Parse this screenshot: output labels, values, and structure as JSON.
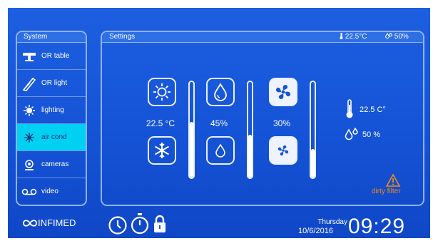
{
  "system": {
    "title": "System",
    "items": [
      {
        "label": "OR table",
        "icon": "or-table-icon",
        "active": false
      },
      {
        "label": "OR light",
        "icon": "or-light-icon",
        "active": false
      },
      {
        "label": "lighting",
        "icon": "lighting-icon",
        "active": false
      },
      {
        "label": "air cond",
        "icon": "air-cond-icon",
        "active": true
      },
      {
        "label": "cameras",
        "icon": "camera-icon",
        "active": false
      },
      {
        "label": "video",
        "icon": "video-icon",
        "active": false
      }
    ],
    "active_color": "#00d0f2"
  },
  "settings": {
    "title": "Settings",
    "header_temp": "22.5°C",
    "header_humidity": "50%",
    "temp_value": "22.5 °C",
    "humidity_value": "45%",
    "fan_value": "30%",
    "reading_temp": "22.5 C°",
    "reading_humidity": "50 %",
    "warning": "dirty filter",
    "warning_color": "#f08a14",
    "temp_level": 0.58,
    "humidity_level": 0.45,
    "fan_level": 0.3
  },
  "footer": {
    "brand": "INFIMED",
    "day": "Thursday",
    "date": "10/6/2016",
    "time": "09:29"
  }
}
